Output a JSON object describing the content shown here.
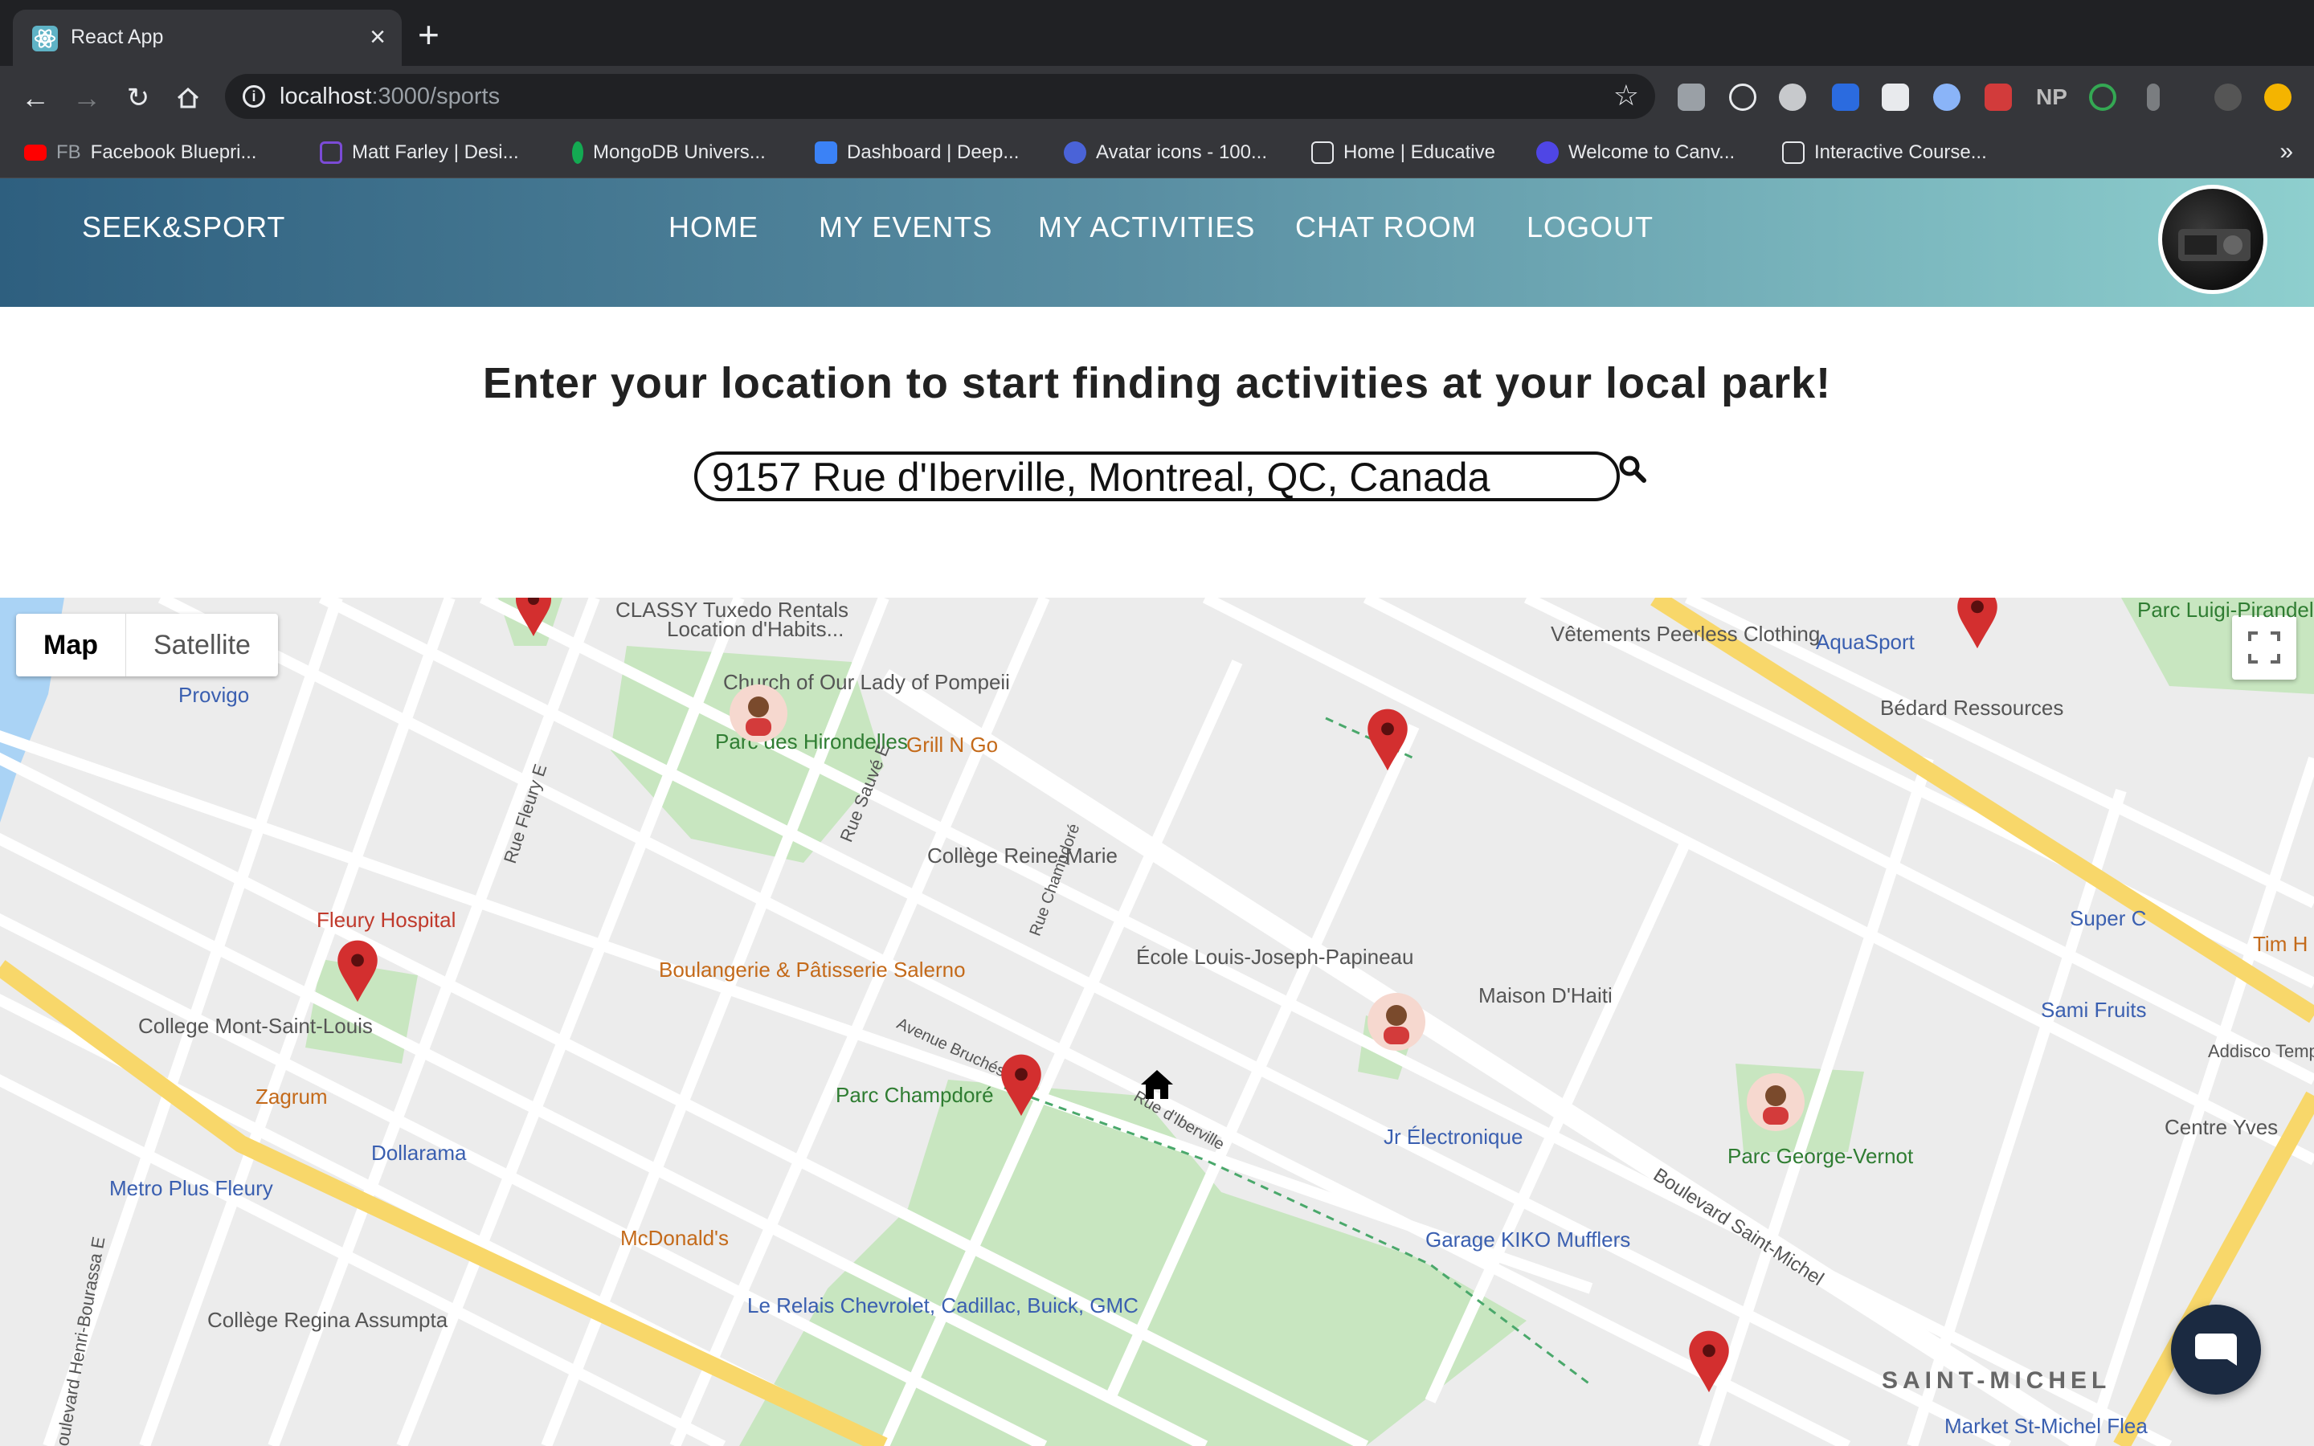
{
  "browser": {
    "tab_title": "React App",
    "url_host": "localhost",
    "url_rest": ":3000/sports",
    "bookmarks": [
      {
        "label": "Facebook Bluepri...",
        "icon": "youtube-fb-icon",
        "color": "#ff0000"
      },
      {
        "label": "Matt Farley | Desi...",
        "icon": "chart-icon",
        "color": "#7b4bd6"
      },
      {
        "label": "MongoDB Univers...",
        "icon": "leaf-icon",
        "color": "#13aa52"
      },
      {
        "label": "Dashboard | Deep...",
        "icon": "deep-icon",
        "color": "#3b82f6"
      },
      {
        "label": "Avatar icons - 100...",
        "icon": "hex-icon",
        "color": "#4a63d8"
      },
      {
        "label": "Home | Educative",
        "icon": "educative-icon",
        "color": "#e8eaed"
      },
      {
        "label": "Welcome to Canv...",
        "icon": "canva-icon",
        "color": "#4f46e5"
      },
      {
        "label": "Interactive Course...",
        "icon": "course-icon",
        "color": "#e8eaed"
      }
    ],
    "fb_prefix": "FB"
  },
  "app": {
    "brand": "SEEK&SPORT",
    "nav": [
      "HOME",
      "MY EVENTS",
      "MY ACTIVITIES",
      "CHAT ROOM",
      "LOGOUT"
    ],
    "prompt": "Enter your location to start finding activities at your local park!",
    "search_value": "9157 Rue d'Iberville, Montreal, QC, Canada"
  },
  "map": {
    "type_options": [
      "Map",
      "Satellite"
    ],
    "selected_type": "Map",
    "labels": {
      "parks": [
        "Parc des Hirondelles",
        "Parc Champdoré",
        "Parc George-Vernot",
        "Parc Luigi-Pirandello"
      ],
      "pois": [
        "CLASSY Tuxedo Rentals",
        "Location d'Habits...",
        "Church of Our Lady of Pompeii",
        "Collège Reine-Marie",
        "École Louis-Joseph-Papineau",
        "Maison D'Haiti",
        "College Mont-Saint-Louis",
        "Collège Regina Assumpta",
        "Vêtements Peerless Clothing",
        "Bédard Ressources"
      ],
      "food": [
        "Grill N Go",
        "Boulangerie & Pâtisserie Salerno",
        "Zagrum",
        "McDonald's",
        "Tim H"
      ],
      "shops": [
        "Provigo",
        "AquaSport",
        "Super C",
        "Sami Fruits",
        "Dollarama",
        "Metro Plus Fleury",
        "Jr Électronique",
        "Garage KIKO Mufflers",
        "Le Relais Chevrolet, Cadillac, Buick, GMC",
        "Market St-Michel Flea"
      ],
      "hospital": "Fleury Hospital",
      "district": "SAINT-MICHEL",
      "roads": [
        "Boulevard Saint-Michel",
        "Rue Fleury E",
        "Rue Sauvé E",
        "Boulevard Henri-Bourassa E",
        "Avenue Bruchési",
        "Rue d'Iberville",
        "Rue Champdoré",
        "Centre Yves",
        "Addisco Tempora"
      ]
    },
    "markers": [
      {
        "kind": "pin",
        "name": "pin-1"
      },
      {
        "kind": "pin",
        "name": "pin-2"
      },
      {
        "kind": "pin",
        "name": "pin-3"
      },
      {
        "kind": "pin",
        "name": "pin-4"
      },
      {
        "kind": "pin",
        "name": "pin-5"
      },
      {
        "kind": "pin",
        "name": "pin-6"
      },
      {
        "kind": "avatar",
        "name": "player-1"
      },
      {
        "kind": "avatar",
        "name": "player-2"
      },
      {
        "kind": "avatar",
        "name": "player-3"
      },
      {
        "kind": "home",
        "name": "home"
      }
    ],
    "colors": {
      "road_major": "#f8d76a",
      "park": "#c8e6c0",
      "pin": "#d32f2f",
      "water": "#aad3f5"
    }
  }
}
